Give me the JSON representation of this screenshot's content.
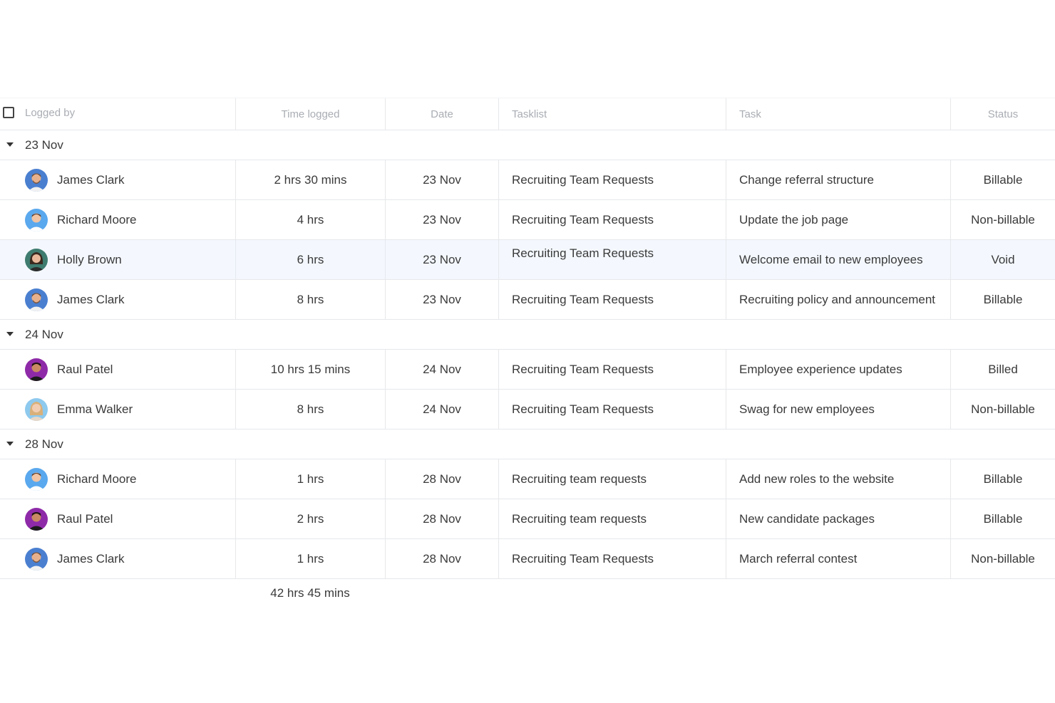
{
  "header": {
    "logged_by": "Logged by",
    "time_logged": "Time logged",
    "date": "Date",
    "tasklist": "Tasklist",
    "task": "Task",
    "status": "Status"
  },
  "groups": [
    {
      "label": "23 Nov",
      "rows": [
        {
          "name": "James Clark",
          "avatar": "avatar-james",
          "time": "2 hrs 30 mins",
          "date": "23 Nov",
          "tasklist": "Recruiting Team Requests",
          "task": "Change referral structure",
          "status": "Billable"
        },
        {
          "name": "Richard Moore",
          "avatar": "avatar-richard",
          "time": "4 hrs",
          "date": "23 Nov",
          "tasklist": "Recruiting Team Requests",
          "task": "Update the job page",
          "status": "Non-billable"
        },
        {
          "name": "Holly Brown",
          "avatar": "avatar-holly",
          "time": "6 hrs",
          "date": "23 Nov",
          "tasklist": "Recruiting Team Requests",
          "task": "Welcome email to new employees",
          "status": "Void"
        },
        {
          "name": "James Clark",
          "avatar": "avatar-james",
          "time": "8 hrs",
          "date": "23 Nov",
          "tasklist": "Recruiting Team Requests",
          "task": "Recruiting policy and announcement",
          "status": "Billable"
        }
      ]
    },
    {
      "label": "24 Nov",
      "rows": [
        {
          "name": "Raul Patel",
          "avatar": "avatar-raul",
          "time": "10 hrs 15 mins",
          "date": "24 Nov",
          "tasklist": "Recruiting Team Requests",
          "task": "Employee experience updates",
          "status": "Billed"
        },
        {
          "name": "Emma Walker",
          "avatar": "avatar-emma",
          "time": "8 hrs",
          "date": "24 Nov",
          "tasklist": "Recruiting Team Requests",
          "task": "Swag for new employees",
          "status": "Non-billable"
        }
      ]
    },
    {
      "label": "28 Nov",
      "rows": [
        {
          "name": "Richard Moore",
          "avatar": "avatar-richard",
          "time": "1 hrs",
          "date": "28 Nov",
          "tasklist": "Recruiting team requests",
          "task": "Add new roles to the website",
          "status": "Billable"
        },
        {
          "name": "Raul Patel",
          "avatar": "avatar-raul",
          "time": "2 hrs",
          "date": "28 Nov",
          "tasklist": "Recruiting team requests",
          "task": "New candidate packages",
          "status": "Billable"
        },
        {
          "name": "James Clark",
          "avatar": "avatar-james",
          "time": "1 hrs",
          "date": "28 Nov",
          "tasklist": "Recruiting Team Requests",
          "task": "March referral contest",
          "status": "Non-billable"
        }
      ]
    }
  ],
  "footer": {
    "total": "42 hrs 45 mins"
  },
  "colors": {
    "highlight_row": "#f4f8fe",
    "grid_line": "#e6e8eb",
    "header_text": "#a9adb3"
  }
}
